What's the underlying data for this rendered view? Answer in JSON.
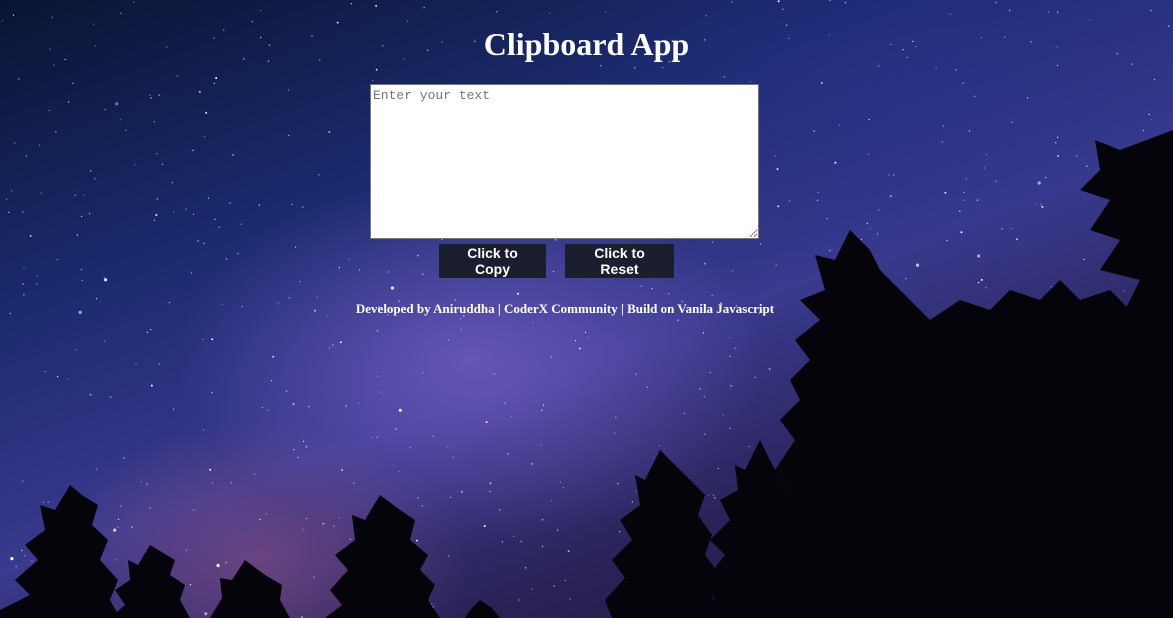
{
  "app": {
    "title": "Clipboard App"
  },
  "editor": {
    "placeholder": "Enter your text",
    "value": ""
  },
  "actions": {
    "copy_label": "Click to Copy",
    "reset_label": "Click to Reset"
  },
  "footer": {
    "text": "Developed by Aniruddha | CoderX Community | Build on Vanila Javascript"
  },
  "background": {
    "description_icon": "starry-night-background",
    "colors": {
      "sky_dark": "#0a1432",
      "sky_mid": "#3a3a8e",
      "tree_silhouette": "#05040a",
      "button_bg": "#1a1e2e"
    }
  }
}
